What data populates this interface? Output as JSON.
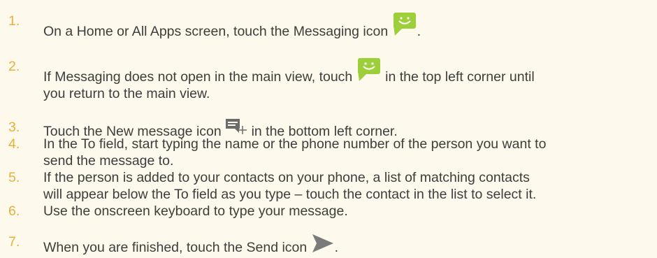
{
  "steps": [
    {
      "number": "1.",
      "before": "On a Home or All Apps screen, touch the Messaging icon",
      "icon": "messaging-smiley-icon",
      "after": "."
    },
    {
      "number": "2.",
      "before": "If Messaging does not open in the main view, touch",
      "icon": "messaging-smiley-icon",
      "after": "in the top left corner until",
      "line2": "you return to the main view."
    },
    {
      "number": "3.",
      "before": "Touch the New message icon",
      "icon": "new-message-plus-icon",
      "after": "in the bottom left corner."
    },
    {
      "number": "4.",
      "line1": "In the To field, start typing the name or the phone number of the person you want to",
      "line2": "send the message to."
    },
    {
      "number": "5.",
      "line1": "If the person is added to your contacts on your phone, a list of matching contacts",
      "line2": "will appear below the To field as you type – touch the contact in the list to select it."
    },
    {
      "number": "6.",
      "line1": "Use the onscreen keyboard to type your message."
    },
    {
      "number": "7.",
      "before": "When you are finished, touch the Send icon",
      "icon": "send-arrow-icon",
      "after": "."
    }
  ],
  "colors": {
    "background": "#fdf9ec",
    "number": "#e7b03c",
    "text": "#3d3d3d",
    "messaging_icon": "#9ccf3a",
    "send_icon": "#7a7a7a",
    "new_message_icon": "#6b6b6b"
  }
}
